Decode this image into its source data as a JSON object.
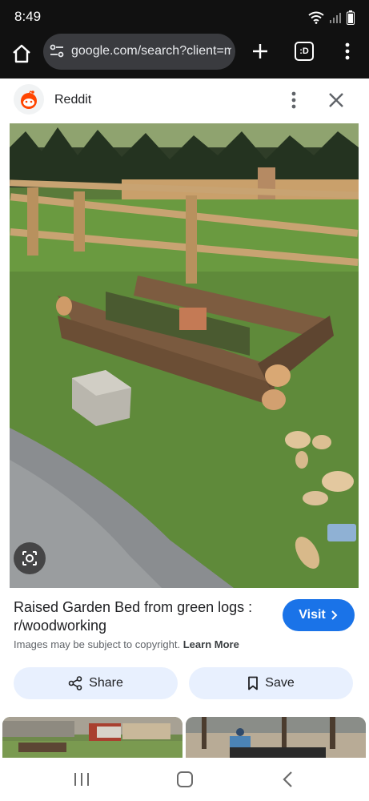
{
  "status_bar": {
    "time": "8:49"
  },
  "browser": {
    "url": "google.com/search?client=ms",
    "tabs_label": ":D"
  },
  "source": {
    "name": "Reddit"
  },
  "result": {
    "title": "Raised Garden Bed from green logs : r/woodworking",
    "visit_label": "Visit",
    "copyright_notice": "Images may be subject to copyright.",
    "learn_more": "Learn More"
  },
  "actions": {
    "share_label": "Share",
    "save_label": "Save"
  },
  "colors": {
    "accent": "#1a73e8",
    "pill_bg": "#e8f0fe",
    "toolbar_bg": "#111111",
    "reddit_orange": "#ff4500"
  },
  "icons": [
    "home-icon",
    "tune-icon",
    "plus-icon",
    "tab-switcher-icon",
    "more-vert-icon",
    "reddit-logo",
    "close-icon",
    "lens-icon",
    "chevron-right-icon",
    "share-icon",
    "bookmark-icon",
    "recent-apps-icon",
    "nav-home-icon",
    "back-icon"
  ]
}
